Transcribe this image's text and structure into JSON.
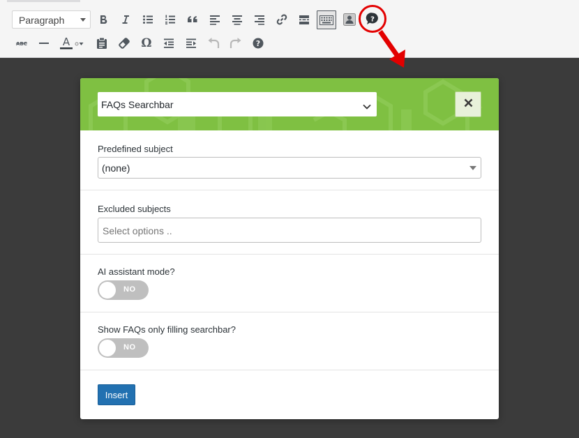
{
  "toolbar": {
    "format_select": {
      "selected": "Paragraph"
    },
    "row1_icons": [
      "bold-icon",
      "italic-icon",
      "bulleted-list-icon",
      "numbered-list-icon",
      "blockquote-icon",
      "align-left-icon",
      "align-center-icon",
      "align-right-icon",
      "link-icon",
      "read-more-icon",
      "toolbar-toggle-icon",
      "user-shortcode-icon",
      "faq-shortcode-icon"
    ],
    "row2_icons": [
      "strikethrough-icon",
      "horizontal-line-icon",
      "text-color-icon",
      "paste-as-text-icon",
      "clear-formatting-icon",
      "special-character-icon",
      "outdent-icon",
      "indent-icon",
      "undo-icon",
      "redo-icon",
      "help-icon"
    ],
    "highlight_color": "#e30000"
  },
  "modal": {
    "header_color": "#7fc042",
    "shortcode_select": {
      "selected": "FAQs Searchbar"
    },
    "fields": {
      "predefined_subject": {
        "label": "Predefined subject",
        "selected": "(none)"
      },
      "excluded_subjects": {
        "label": "Excluded subjects",
        "placeholder": "Select options .."
      },
      "ai_assistant_mode": {
        "label": "AI assistant mode?",
        "state": "NO"
      },
      "show_only_filling": {
        "label": "Show FAQs only filling searchbar?",
        "state": "NO"
      }
    },
    "insert_label": "Insert",
    "button_color": "#2271b1"
  }
}
